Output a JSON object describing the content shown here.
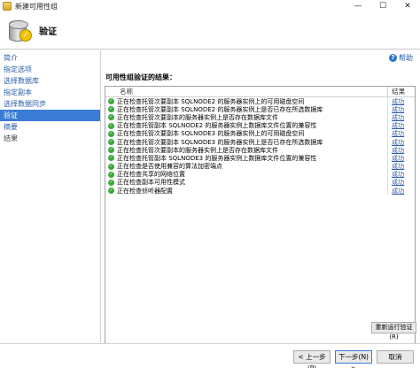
{
  "window": {
    "title": "新建可用性组",
    "minimize": "—",
    "maximize": "☐",
    "close": "✕"
  },
  "header": {
    "title": "验证"
  },
  "sidebar": {
    "items": [
      {
        "label": "简介",
        "state": "link"
      },
      {
        "label": "指定选项",
        "state": "link"
      },
      {
        "label": "选择数据库",
        "state": "link"
      },
      {
        "label": "指定副本",
        "state": "link"
      },
      {
        "label": "选择数据同步",
        "state": "link"
      },
      {
        "label": "验证",
        "state": "active"
      },
      {
        "label": "摘要",
        "state": "link"
      },
      {
        "label": "结果",
        "state": "plain"
      }
    ]
  },
  "main": {
    "help": "帮助",
    "section_title": "可用性组验证的结果：",
    "columns": {
      "name": "名称",
      "result": "结果"
    },
    "rows": [
      {
        "name": "正在检查托管次要副本 SQLNODE2 的服务器实例上的可用磁盘空间",
        "result": "成功"
      },
      {
        "name": "正在检查托管次要副本 SQLNODE2 的服务器实例上是否已存在所选数据库",
        "result": "成功"
      },
      {
        "name": "正在检查托管次要副本的服务器实例上是否存在数据库文件",
        "result": "成功"
      },
      {
        "name": "正在检查托管副本 SQLNODE2 的服务器实例上数据库文件位置的兼容性",
        "result": "成功"
      },
      {
        "name": "正在检查托管次要副本 SQLNODE3 的服务器实例上的可用磁盘空间",
        "result": "成功"
      },
      {
        "name": "正在检查托管次要副本 SQLNODE3 的服务器实例上是否已存在所选数据库",
        "result": "成功"
      },
      {
        "name": "正在检查托管次要副本的服务器实例上是否存在数据库文件",
        "result": "成功"
      },
      {
        "name": "正在检查托管副本 SQLNODE3 的服务器实例上数据库文件位置的兼容性",
        "result": "成功"
      },
      {
        "name": "正在检查是否使用兼容的算法加密端点",
        "result": "成功"
      },
      {
        "name": "正在检查共享的网络位置",
        "result": "成功"
      },
      {
        "name": "正在检查副本可用性模式",
        "result": "成功"
      },
      {
        "name": "正在检查侦听器配置",
        "result": "成功"
      }
    ],
    "rerun": "重新运行验证(R)"
  },
  "footer": {
    "prev": "< 上一步(P)",
    "next": "下一步(N) >",
    "cancel": "取消"
  }
}
